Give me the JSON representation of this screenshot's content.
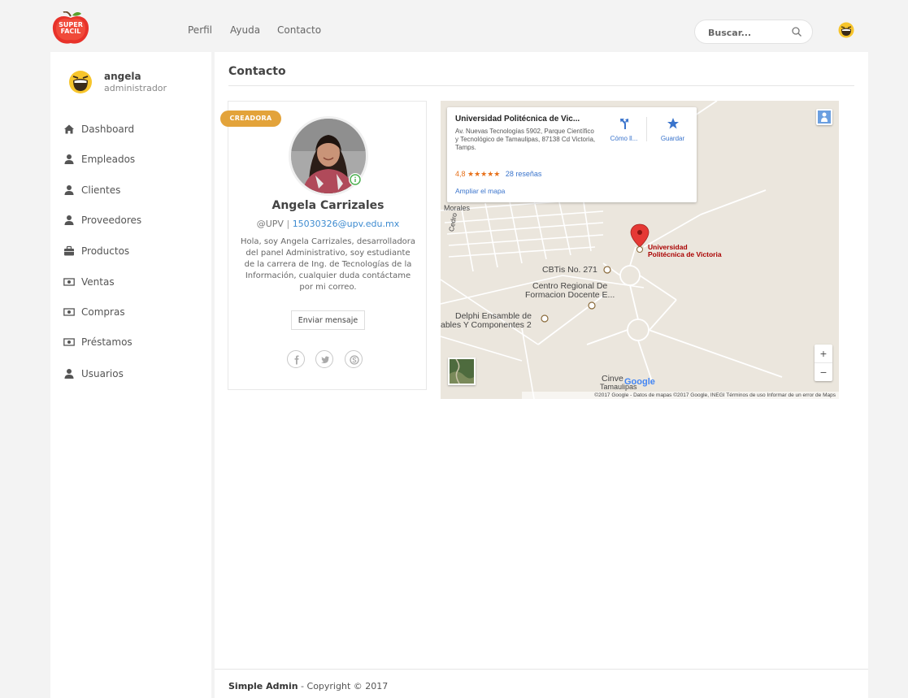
{
  "brand": {
    "logo_top": "SUPER",
    "logo_bottom": "FACIL"
  },
  "nav": {
    "perfil": "Perfil",
    "ayuda": "Ayuda",
    "contacto": "Contacto"
  },
  "search": {
    "placeholder": "Buscar..."
  },
  "sidebar": {
    "user": {
      "name": "angela",
      "role": "administrador"
    },
    "items": [
      {
        "label": "Dashboard",
        "icon": "home-icon"
      },
      {
        "label": "Empleados",
        "icon": "user-icon"
      },
      {
        "label": "Clientes",
        "icon": "user-icon"
      },
      {
        "label": "Proveedores",
        "icon": "user-icon"
      },
      {
        "label": "Productos",
        "icon": "briefcase-icon"
      },
      {
        "label": "Ventas",
        "icon": "money-icon"
      },
      {
        "label": "Compras",
        "icon": "money-icon"
      },
      {
        "label": "Préstamos",
        "icon": "money-icon"
      },
      {
        "label": "Usuarios",
        "icon": "user-icon"
      }
    ]
  },
  "main": {
    "title": "Contacto"
  },
  "profile": {
    "badge": "CREADORA",
    "name": "Angela Carrizales",
    "org": "@UPV",
    "separator": "|",
    "email": "15030326@upv.edu.mx",
    "bio": "Hola, soy Angela Carrizales, desarrolladora del panel Administrativo, soy estudiante de la carrera de Ing. de Tecnologías de la Información, cualquier duda contáctame por mi correo.",
    "message_button": "Enviar mensaje"
  },
  "map": {
    "place_title": "Universidad Politécnica de Vic...",
    "address": "Av. Nuevas Tecnologías 5902, Parque Científico y Tecnológico de Tamaulipas, 87138 Cd Victoria, Tamps.",
    "rating": "4,8",
    "stars": "★★★★★",
    "reviews": "28 reseñas",
    "enlarge": "Ampliar el mapa",
    "directions": "Cómo ll...",
    "save": "Guardar",
    "pin_line1": "Universidad",
    "pin_line2": "Politécnica de Victoria",
    "label_morales": "Morales",
    "label_cedro": "Cedro",
    "label_cbtis": "CBTis No. 271",
    "label_centro1": "Centro Regional De",
    "label_centro2": "Formacion Docente E...",
    "label_delphi1": "Delphi Ensamble de",
    "label_delphi2": "ables Y Componentes 2",
    "label_cinve": "Cinve",
    "label_tamaulipas": "Tamaulipas",
    "google": "Google",
    "zoom_in": "+",
    "zoom_out": "−",
    "footer": "©2017 Google - Datos de mapas ©2017 Google, INEGI    Términos de uso    Informar de un error de Maps",
    "colors": {
      "pin": "#e53935",
      "rating": "#e7711b",
      "link": "#3a74cc"
    }
  },
  "footer": {
    "brand": "Simple Admin",
    "copyright": " - Copyright © 2017"
  },
  "colors": {
    "badge": "#e3a33a",
    "link": "#3d8bd0",
    "online": "#4caf50"
  }
}
